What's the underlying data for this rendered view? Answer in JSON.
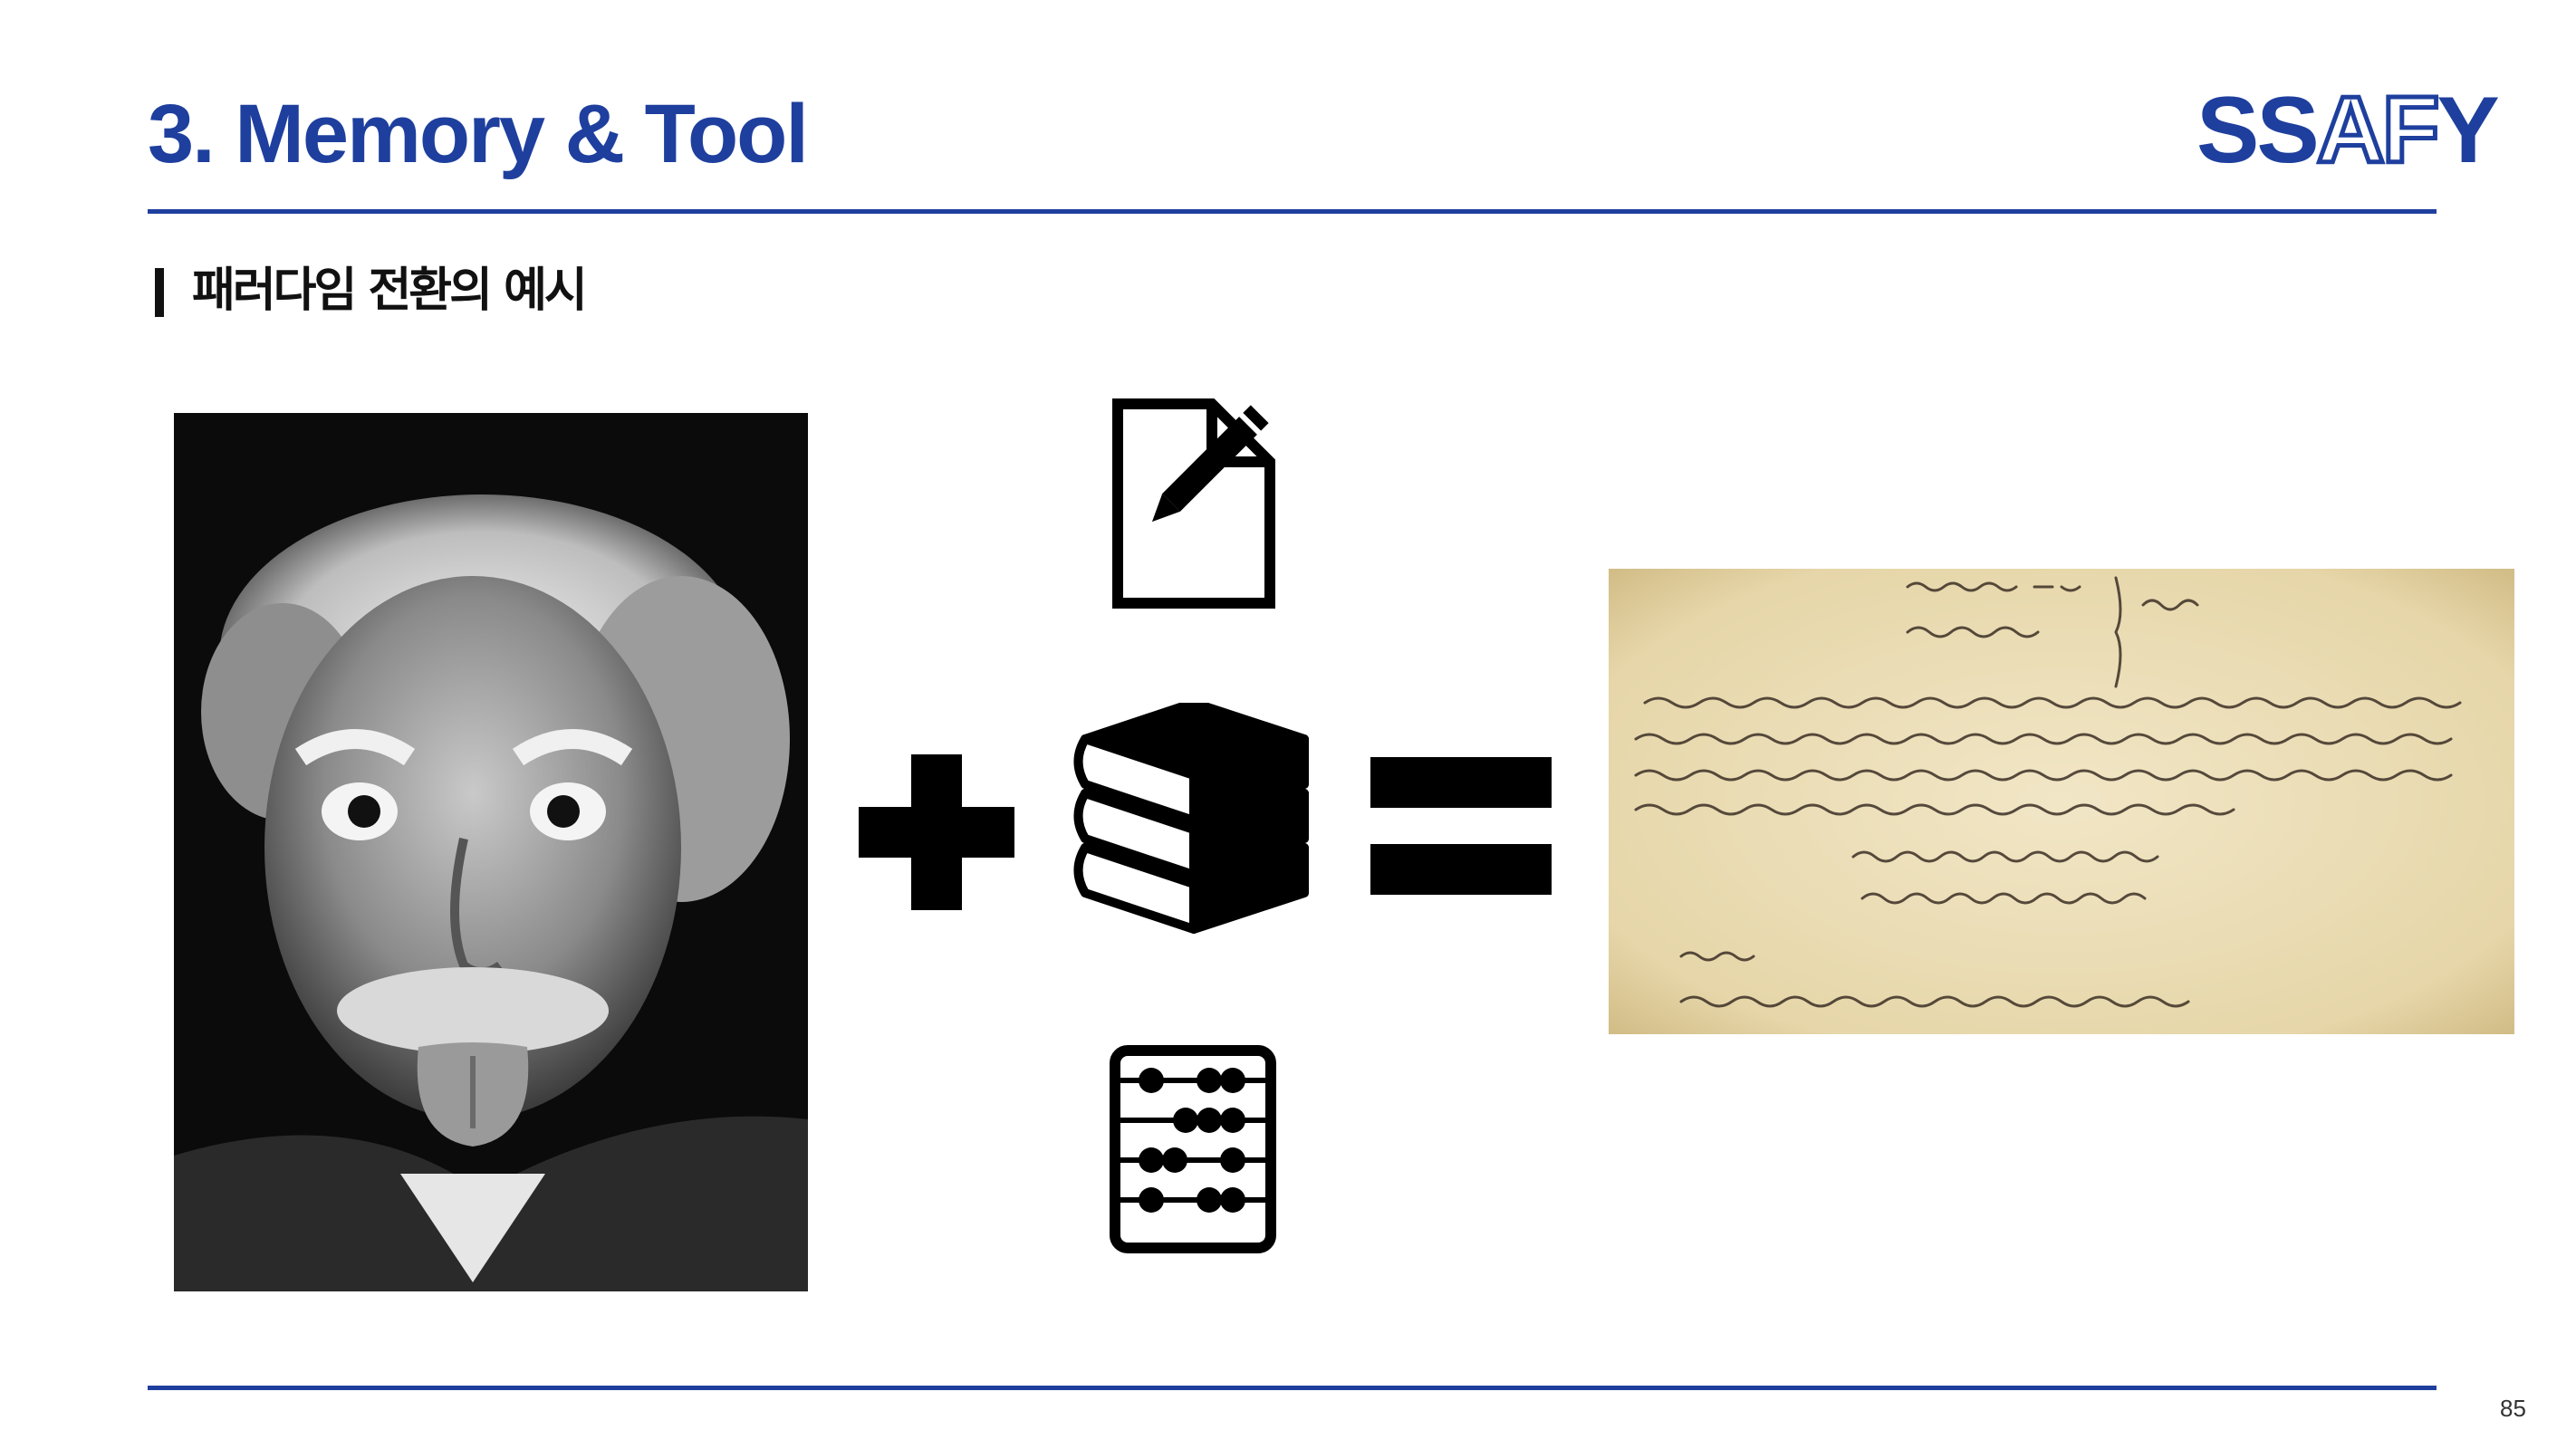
{
  "slide": {
    "title": "3. Memory & Tool",
    "subtitle": "패러다임 전환의 예시",
    "page_number": "85"
  },
  "logo": {
    "part1": "SS",
    "part2": "AF",
    "part3": "Y"
  },
  "icons": {
    "tool_top": "document-pen-icon",
    "tool_middle": "books-icon",
    "tool_bottom": "abacus-icon",
    "plus": "plus-icon",
    "equals": "equals-icon"
  },
  "images": {
    "left": "einstein-photo",
    "right": "handwritten-equations-manuscript"
  },
  "colors": {
    "brand_blue": "#1e3f9e",
    "icon_black": "#000000",
    "paper": "#e9dcb6"
  }
}
